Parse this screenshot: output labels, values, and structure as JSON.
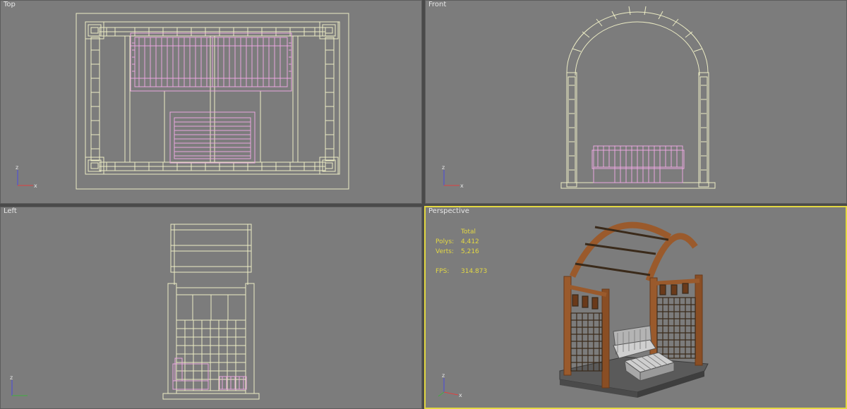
{
  "viewports": {
    "top": {
      "label": "Top"
    },
    "front": {
      "label": "Front"
    },
    "left": {
      "label": "Left"
    },
    "perspective": {
      "label": "Perspective"
    }
  },
  "stats": {
    "header": "Total",
    "polys_label": "Polys:",
    "polys_value": "4,412",
    "verts_label": "Verts:",
    "verts_value": "5,216",
    "fps_label": "FPS:",
    "fps_value": "314.873"
  },
  "axis": {
    "z": "z",
    "x": "x"
  },
  "colors": {
    "viewport_bg": "#7c7c7c",
    "wire_frame": "#ececc4",
    "wire_bench": "#e9a6de",
    "active_border": "#e3d843",
    "wood": "#9a5a2c"
  }
}
